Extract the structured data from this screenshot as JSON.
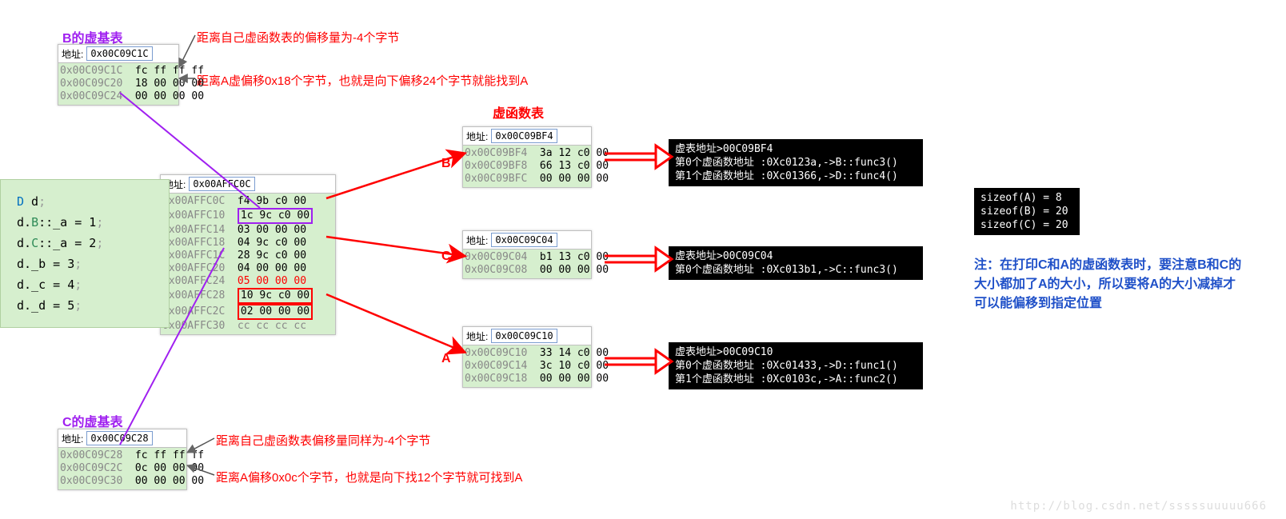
{
  "headings": {
    "b_vbtable": "B的虚基表",
    "c_vbtable": "C的虚基表",
    "vftable": "虚函数表"
  },
  "notes": {
    "b_off_self": "距离自己虚函数表的偏移量为-4个字节",
    "b_off_a": "距离A虚偏移0x18个字节，也就是向下偏移24个字节就能找到A",
    "c_off_self": "距离自己虚函数表偏移量同样为-4个字节",
    "c_off_a": "距离A偏移0x0c个字节，也就是向下找12个字节就可找到A",
    "print_note": "注：在打印C和A的虚函数表时，要注意B和C的大小都加了A的大小，所以要将A的大小减掉才可以能偏移到指定位置"
  },
  "letters": {
    "B": "B",
    "C": "C",
    "A": "A"
  },
  "addr_label": "地址:",
  "mem_b_vb": {
    "addr": "0x00C09C1C",
    "rows": [
      {
        "a": "0x00C09C1C",
        "b": "fc ff ff ff"
      },
      {
        "a": "0x00C09C20",
        "b": "18 00 00 00"
      },
      {
        "a": "0x00C09C24",
        "b": "00 00 00 00"
      }
    ]
  },
  "mem_c_vb": {
    "addr": "0x00C09C28",
    "rows": [
      {
        "a": "0x00C09C28",
        "b": "fc ff ff ff"
      },
      {
        "a": "0x00C09C2C",
        "b": "0c 00 00 00"
      },
      {
        "a": "0x00C09C30",
        "b": "00 00 00 00"
      }
    ]
  },
  "mem_stack": {
    "addr": "0x00AFFC0C",
    "rows": [
      {
        "a": "0x00AFFC0C",
        "b": "f4 9b c0 00"
      },
      {
        "a": "0x00AFFC10",
        "b": "1c 9c c0 00",
        "mark": "purple"
      },
      {
        "a": "0x00AFFC14",
        "b": "03 00 00 00"
      },
      {
        "a": "0x00AFFC18",
        "b": "04 9c c0 00"
      },
      {
        "a": "0x00AFFC1C",
        "b": "28 9c c0 00"
      },
      {
        "a": "0x00AFFC20",
        "b": "04 00 00 00"
      },
      {
        "a": "0x00AFFC24",
        "b": "05 00 00 00",
        "redtext": true
      },
      {
        "a": "0x00AFFC28",
        "b": "10 9c c0 00",
        "mark": "red"
      },
      {
        "a": "0x00AFFC2C",
        "b": "02 00 00 00",
        "mark": "red"
      },
      {
        "a": "0x00AFFC30",
        "b": "cc cc cc cc",
        "grey": true
      }
    ]
  },
  "mem_vft_b": {
    "addr": "0x00C09BF4",
    "rows": [
      {
        "a": "0x00C09BF4",
        "b": "3a 12 c0 00"
      },
      {
        "a": "0x00C09BF8",
        "b": "66 13 c0 00"
      },
      {
        "a": "0x00C09BFC",
        "b": "00 00 00 00"
      }
    ]
  },
  "mem_vft_c": {
    "addr": "0x00C09C04",
    "rows": [
      {
        "a": "0x00C09C04",
        "b": "b1 13 c0 00"
      },
      {
        "a": "0x00C09C08",
        "b": "00 00 00 00"
      }
    ]
  },
  "mem_vft_a": {
    "addr": "0x00C09C10",
    "rows": [
      {
        "a": "0x00C09C10",
        "b": "33 14 c0 00"
      },
      {
        "a": "0x00C09C14",
        "b": "3c 10 c0 00"
      },
      {
        "a": "0x00C09C18",
        "b": "00 00 00 00"
      }
    ]
  },
  "terms": {
    "b": "虚表地址>00C09BF4\n第0个虚函数地址 :0Xc0123a,->B::func3()\n第1个虚函数地址 :0Xc01366,->D::func4()",
    "c": "虚表地址>00C09C04\n第0个虚函数地址 :0Xc013b1,->C::func3()",
    "a": "虚表地址>00C09C10\n第0个虚函数地址 :0Xc01433,->D::func1()\n第1个虚函数地址 :0Xc0103c,->A::func2()",
    "sizeof": "sizeof(A) = 8\nsizeof(B) = 20\nsizeof(C) = 20"
  },
  "code": {
    "l1_a": "D",
    "l1_b": " d",
    "l2_a": "d.",
    "l2_b": "B",
    "l2_c": "::_a = 1",
    "l3_a": "d.",
    "l3_b": "C",
    "l3_c": "::_a = 2",
    "l4": "d._b = 3",
    "l5": "d._c = 4",
    "l6": "d._d = 5"
  },
  "watermark": "http://blog.csdn.net/sssssuuuuu666"
}
